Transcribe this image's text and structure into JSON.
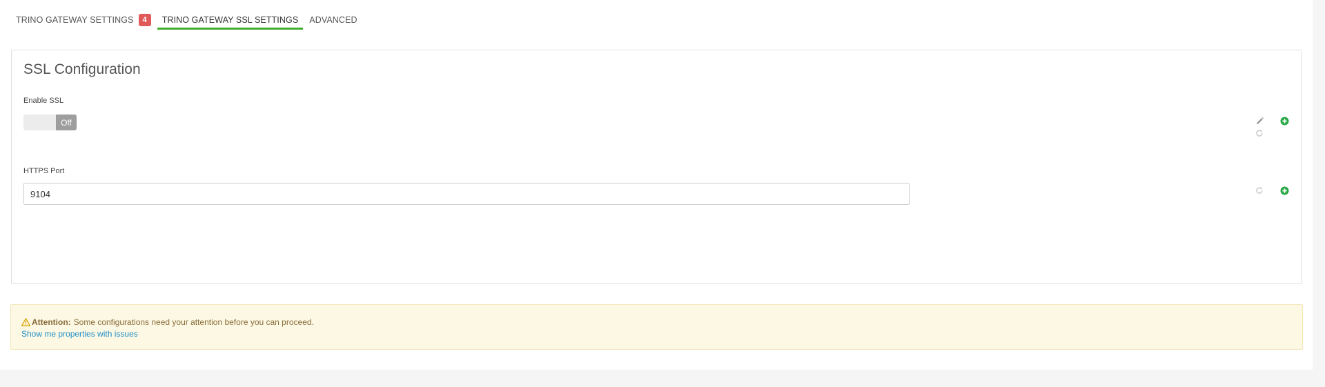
{
  "tabs": [
    {
      "label": "TRINO GATEWAY SETTINGS",
      "badge": "4"
    },
    {
      "label": "TRINO GATEWAY SSL SETTINGS"
    },
    {
      "label": "ADVANCED"
    }
  ],
  "active_tab": "TRINO GATEWAY SSL SETTINGS",
  "panel": {
    "title": "SSL Configuration",
    "enable_ssl": {
      "label": "Enable SSL",
      "state": "Off"
    },
    "https_port": {
      "label": "HTTPS Port",
      "value": "9104"
    }
  },
  "alert": {
    "strong": "Attention:",
    "message": "Some configurations need your attention before you can proceed.",
    "link": "Show me properties with issues"
  },
  "icons": {
    "edit": "pencil-icon",
    "undo": "undo-icon",
    "add": "plus-circle-icon"
  },
  "colors": {
    "active_tab_underline": "#3fae2a",
    "badge": "#e05a5a",
    "add_icon": "#28a745",
    "alert_bg": "#fcf8e3",
    "alert_text": "#8a6d3b",
    "link": "#1f8ec9",
    "toggle_off": "#9e9e9e"
  }
}
